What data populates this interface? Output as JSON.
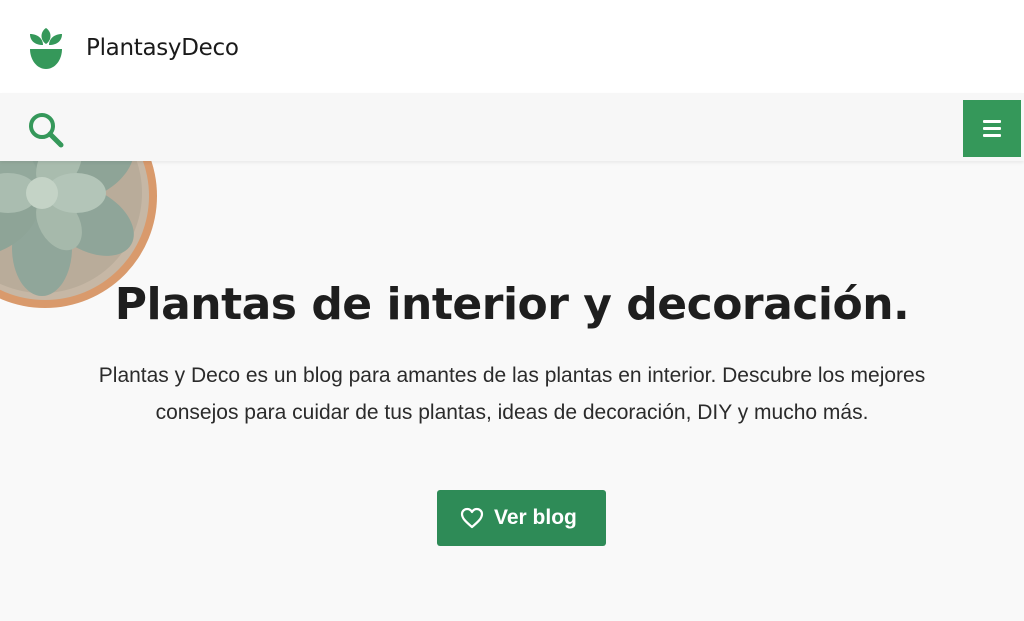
{
  "header": {
    "brand": "PlantasyDeco",
    "logo_icon": "sprout-pot-logo"
  },
  "nav": {
    "search_icon": "search-icon",
    "menu_icon": "hamburger-icon"
  },
  "hero": {
    "title": "Plantas de interior y decoración.",
    "description": "Plantas y Deco es un blog para amantes de las plantas en interior. Descubre los mejores consejos para cuidar de tus plantas, ideas de decoración, DIY y mucho más.",
    "cta_label": "Ver blog",
    "cta_icon": "heart-icon"
  },
  "colors": {
    "accent": "#35985a",
    "button": "#2e8b57",
    "text": "#1e1e1e",
    "background": "#f9f9f9"
  }
}
